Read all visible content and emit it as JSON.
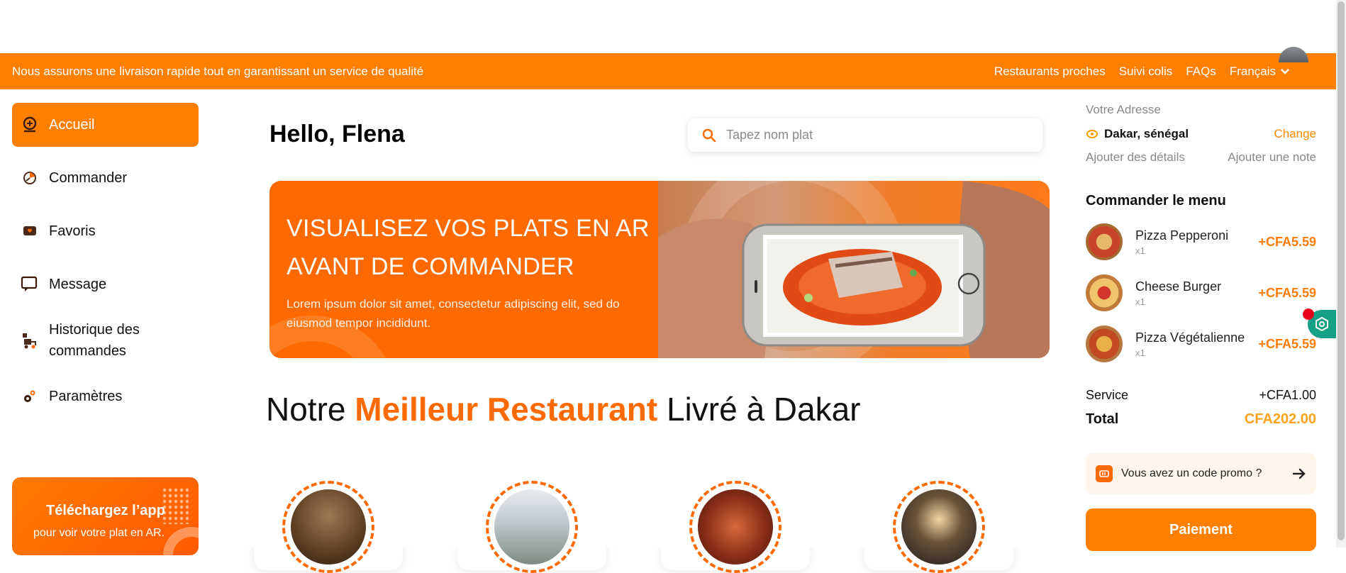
{
  "topbar": {
    "tagline": "Nous assurons une livraison rapide tout en garantissant un service de qualité",
    "links": [
      "Restaurants proches",
      "Suivi colis",
      "FAQs"
    ],
    "language": "Français"
  },
  "sidebar": {
    "items": [
      {
        "label": "Accueil",
        "icon": "home-icon"
      },
      {
        "label": "Commander",
        "icon": "order-icon"
      },
      {
        "label": "Favoris",
        "icon": "favorites-icon"
      },
      {
        "label": "Message",
        "icon": "message-icon"
      },
      {
        "label": "Historique des commandes",
        "icon": "history-icon"
      },
      {
        "label": "Paramètres",
        "icon": "settings-icon"
      }
    ],
    "app_card": {
      "title": "Téléchargez l’app",
      "subtitle": "pour voir votre plat en AR."
    }
  },
  "main": {
    "greeting": "Hello, Flena",
    "search_placeholder": "Tapez nom plat",
    "banner": {
      "title": "VISUALISEZ VOS PLATS EN AR AVANT DE COMMANDER",
      "text": "Lorem ipsum dolor sit amet, consectetur adipiscing elit, sed do eiusmod tempor incididunt."
    },
    "headline": {
      "part1": "Notre",
      "highlight": "Meilleur Restaurant",
      "part2": "Livré à Dakar"
    }
  },
  "right": {
    "address_label": "Votre Adresse",
    "address": "Dakar, sénégal",
    "change": "Change",
    "add_details": "Ajouter des détails",
    "add_note": "Ajouter une note",
    "order_title": "Commander le menu",
    "items": [
      {
        "name": "Pizza Pepperoni",
        "qty": "x1",
        "price": "+CFA5.59"
      },
      {
        "name": "Cheese Burger",
        "qty": "x1",
        "price": "+CFA5.59"
      },
      {
        "name": "Pizza Végétalienne",
        "qty": "x1",
        "price": "+CFA5.59"
      }
    ],
    "service_label": "Service",
    "service_value": "+CFA1.00",
    "total_label": "Total",
    "total_value": "CFA202.00",
    "promo": "Vous avez un code promo ?",
    "pay": "Paiement"
  },
  "colors": {
    "accent": "#ff8000",
    "banner": "#ff6a00",
    "price": "#ff7a00",
    "total": "#ffa21c"
  }
}
